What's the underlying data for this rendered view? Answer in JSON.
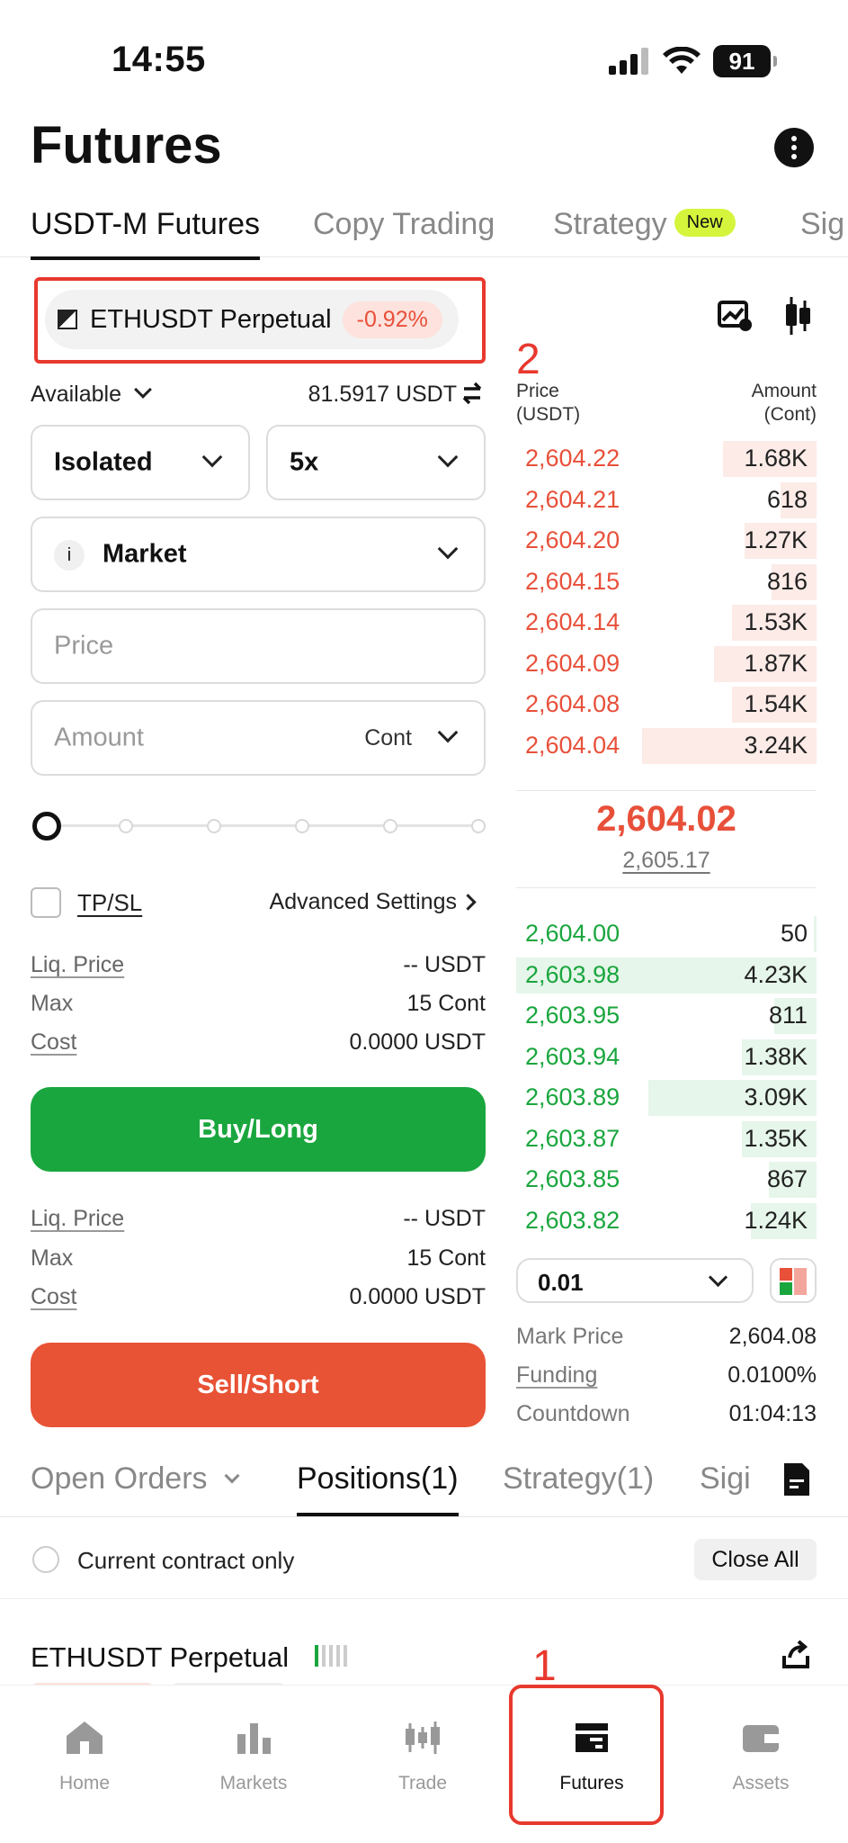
{
  "status": {
    "time": "14:55",
    "battery": "91"
  },
  "header": {
    "title": "Futures"
  },
  "top_tabs": [
    {
      "label": "USDT-M Futures"
    },
    {
      "label": "Copy Trading"
    },
    {
      "label": "Strategy",
      "badge": "New"
    },
    {
      "label": "Sig"
    }
  ],
  "symbol": {
    "name": "ETHUSDT Perpetual",
    "change": "-0.92%"
  },
  "annotations": {
    "a1": "1",
    "a2": "2"
  },
  "form": {
    "available_label": "Available",
    "available_value": "81.5917 USDT",
    "margin_mode": "Isolated",
    "leverage": "5x",
    "order_type": "Market",
    "price_placeholder": "Price",
    "amount_placeholder": "Amount",
    "amount_unit": "Cont",
    "slider_value": 0,
    "tpsl_label": "TP/SL",
    "advanced_label": "Advanced Settings",
    "buy": {
      "liq_label": "Liq. Price",
      "liq_value": "-- USDT",
      "max_label": "Max",
      "max_value": "15 Cont",
      "cost_label": "Cost",
      "cost_value": "0.0000 USDT"
    },
    "sell": {
      "liq_label": "Liq. Price",
      "liq_value": "-- USDT",
      "max_label": "Max",
      "max_value": "15 Cont",
      "cost_label": "Cost",
      "cost_value": "0.0000 USDT"
    },
    "buy_label": "Buy/Long",
    "sell_label": "Sell/Short"
  },
  "orderbook": {
    "price_header": "Price\n(USDT)",
    "amount_header": "Amount\n(Cont)",
    "asks": [
      {
        "price": "2,604.22",
        "amount": "1.68K",
        "depth": 0.31
      },
      {
        "price": "2,604.21",
        "amount": "618",
        "depth": 0.12
      },
      {
        "price": "2,604.20",
        "amount": "1.27K",
        "depth": 0.24
      },
      {
        "price": "2,604.15",
        "amount": "816",
        "depth": 0.15
      },
      {
        "price": "2,604.14",
        "amount": "1.53K",
        "depth": 0.28
      },
      {
        "price": "2,604.09",
        "amount": "1.87K",
        "depth": 0.34
      },
      {
        "price": "2,604.08",
        "amount": "1.54K",
        "depth": 0.28
      },
      {
        "price": "2,604.04",
        "amount": "3.24K",
        "depth": 0.58
      }
    ],
    "last_price": "2,604.02",
    "mark_price_mid": "2,605.17",
    "bids": [
      {
        "price": "2,604.00",
        "amount": "50",
        "depth": 0.01
      },
      {
        "price": "2,603.98",
        "amount": "4.23K",
        "depth": 1.0
      },
      {
        "price": "2,603.95",
        "amount": "811",
        "depth": 0.14
      },
      {
        "price": "2,603.94",
        "amount": "1.38K",
        "depth": 0.25
      },
      {
        "price": "2,603.89",
        "amount": "3.09K",
        "depth": 0.56
      },
      {
        "price": "2,603.87",
        "amount": "1.35K",
        "depth": 0.25
      },
      {
        "price": "2,603.85",
        "amount": "867",
        "depth": 0.16
      },
      {
        "price": "2,603.82",
        "amount": "1.24K",
        "depth": 0.22
      }
    ],
    "precision": "0.01",
    "mark_label": "Mark Price",
    "mark_value": "2,604.08",
    "funding_label": "Funding",
    "funding_value": "0.0100%",
    "countdown_label": "Countdown",
    "countdown_value": "01:04:13"
  },
  "bottom_tabs": [
    {
      "label": "Open Orders"
    },
    {
      "label": "Positions(1)"
    },
    {
      "label": "Strategy(1)"
    },
    {
      "label": "Sigi"
    }
  ],
  "positions": {
    "current_only_label": "Current contract only",
    "close_all_label": "Close All",
    "symbol": "ETHUSDT Perpetual"
  },
  "nav": [
    {
      "label": "Home",
      "icon": "home-icon"
    },
    {
      "label": "Markets",
      "icon": "markets-icon"
    },
    {
      "label": "Trade",
      "icon": "trade-icon"
    },
    {
      "label": "Futures",
      "icon": "futures-icon"
    },
    {
      "label": "Assets",
      "icon": "assets-icon"
    }
  ],
  "colors": {
    "ask": "#e8503a",
    "bid": "#1aa63e",
    "annotation": "#e8392e"
  }
}
